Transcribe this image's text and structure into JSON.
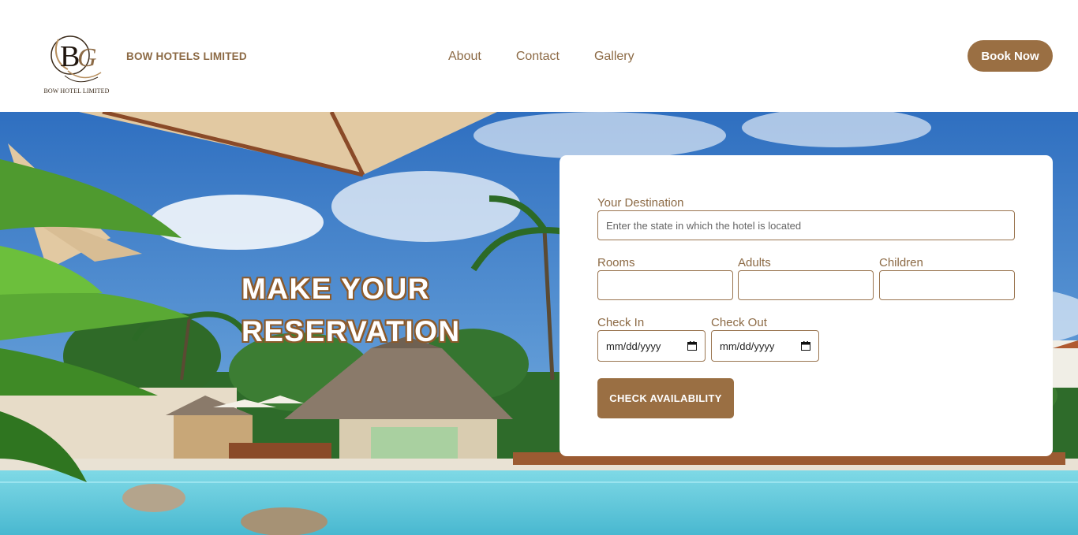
{
  "header": {
    "logo_caption": "BOW HOTEL LIMITED",
    "brand": "BOW HOTELS LIMITED",
    "nav": [
      {
        "label": "About"
      },
      {
        "label": "Contact"
      },
      {
        "label": "Gallery"
      }
    ],
    "book_now": "Book Now"
  },
  "hero": {
    "title_line1": "MAKE YOUR",
    "title_line2": "RESERVATION"
  },
  "form": {
    "destination_label": "Your Destination",
    "destination_placeholder": "Enter the state in which the hotel is located",
    "destination_value": "",
    "rooms_label": "Rooms",
    "adults_label": "Adults",
    "children_label": "Children",
    "check_in_label": "Check In",
    "check_out_label": "Check Out",
    "check_in_value": "mm/dd/yyyy",
    "check_out_value": "mm/dd/yyyy",
    "submit_label": "CHECK AVAILABILITY"
  },
  "colors": {
    "brand": "#9a6f43",
    "text_accent": "#8c6a45",
    "sky": "#3f7fc8",
    "pool": "#6ccfe0"
  },
  "icons": {
    "calendar": "calendar-icon"
  }
}
